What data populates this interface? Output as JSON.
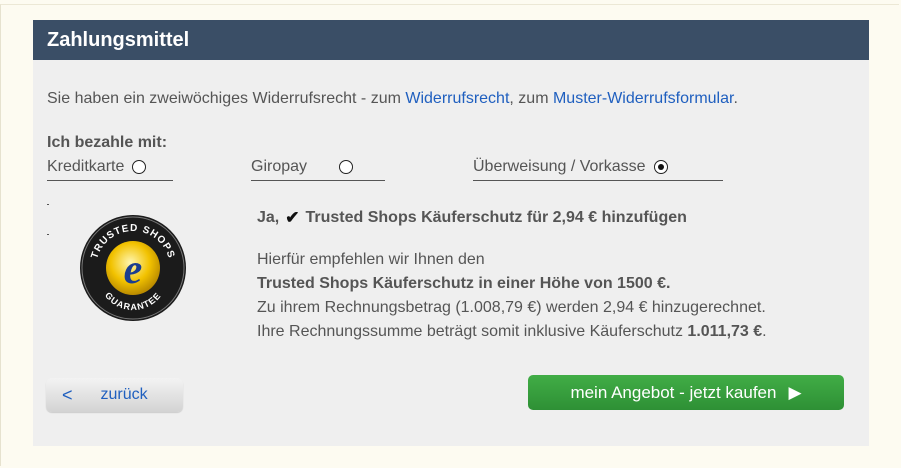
{
  "panel": {
    "title": "Zahlungsmittel"
  },
  "notice": {
    "prefix": "Sie haben ein zweiwöchiges Widerrufsrecht - zum ",
    "link1": "Widerrufsrecht",
    "mid": ", zum ",
    "link2": "Muster-Widerrufsformular",
    "suffix": "."
  },
  "payment": {
    "label": "Ich bezahle mit:",
    "methods": [
      {
        "label": "Kreditkarte",
        "selected": false
      },
      {
        "label": "Giropay",
        "selected": false
      },
      {
        "label": "Überweisung / Vorkasse",
        "selected": true
      }
    ]
  },
  "protection": {
    "yes_label": "Ja,",
    "checked": true,
    "offer": "Trusted Shops Käuferschutz für 2,94 € hinzufügen",
    "line1": "Hierfür empfehlen wir Ihnen den",
    "line2": "Trusted Shops Käuferschutz in einer Höhe von 1500 €.",
    "line3": "Zu ihrem Rechnungsbetrag (1.008,79 €) werden 2,94 € hinzugerechnet.",
    "line4_prefix": "Ihre Rechnungssumme beträgt somit inklusive Käuferschutz ",
    "line4_total": "1.011,73 €",
    "line4_suffix": "."
  },
  "logo": {
    "top_text": "TRUSTED SHOPS",
    "bottom_text": "GUARANTEE",
    "letter": "e",
    "icon": "trusted-shops-seal"
  },
  "buttons": {
    "back_arrow": "<",
    "back_label": "zurück",
    "buy_label": "mein Angebot - jetzt kaufen",
    "buy_arrow": "▶"
  },
  "colors": {
    "header": "#3a4e66",
    "link": "#1f5fbf",
    "buy": "#35a03b",
    "panel": "#efefef"
  }
}
